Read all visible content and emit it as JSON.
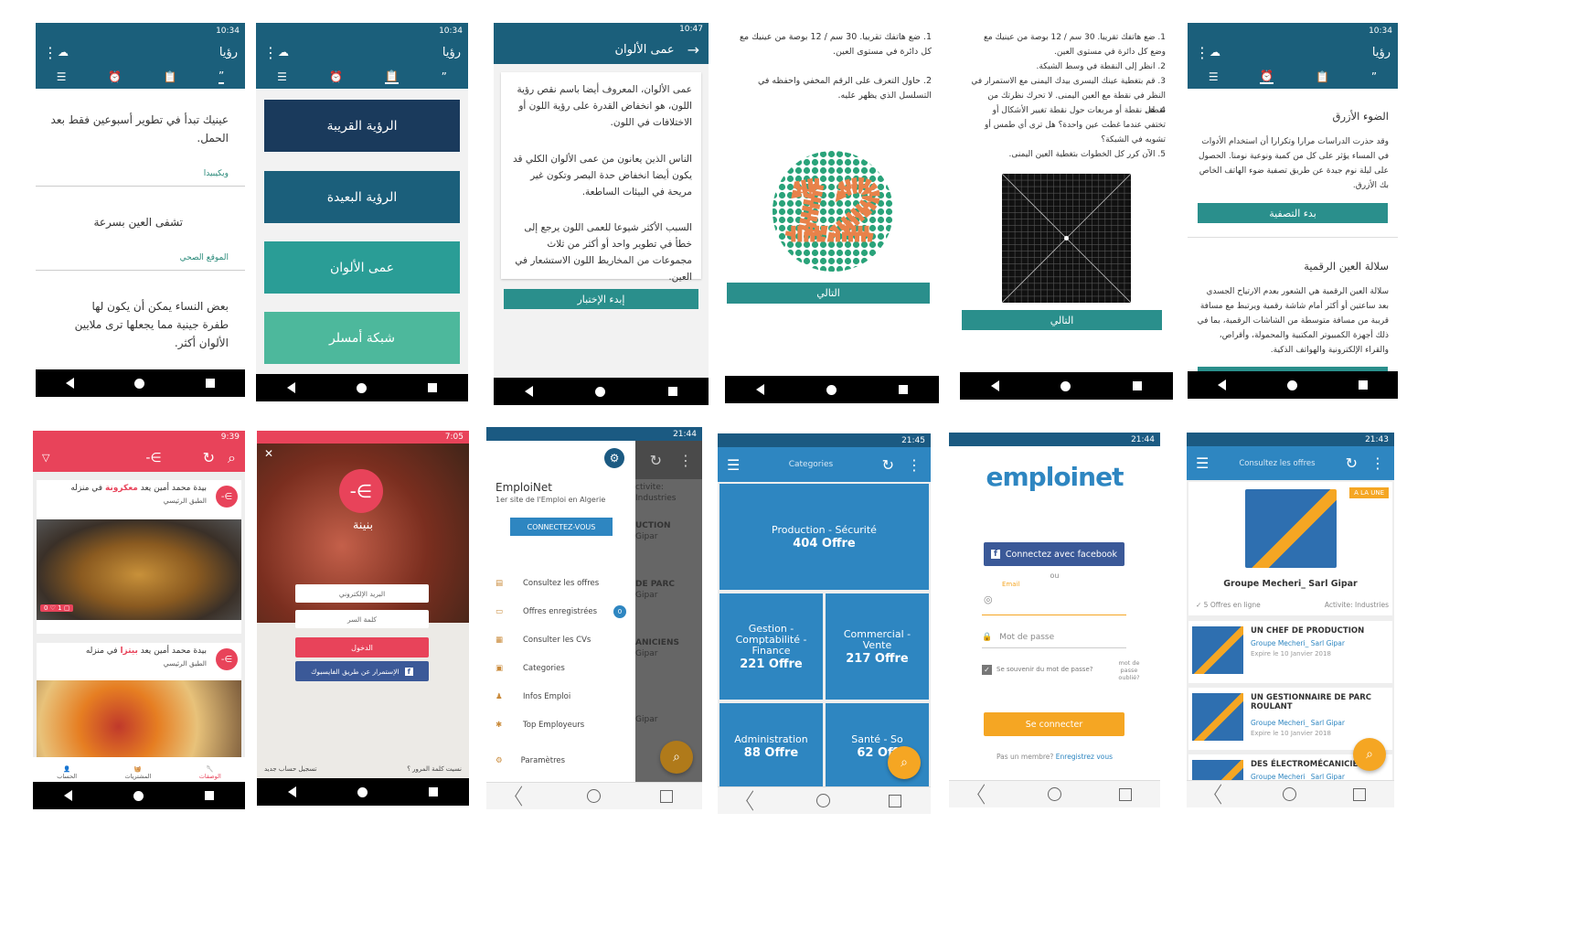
{
  "status": {
    "time1": "10:34",
    "time2": "10:34",
    "time3": "10:47",
    "time4": "10:34",
    "time5": "9:39",
    "time6": "7:05",
    "time7": "21:44",
    "time8": "21:45",
    "time9": "21:44",
    "time10": "21:43"
  },
  "s1": {
    "title": "رؤيا",
    "items": [
      {
        "text": "عينيك تبدأ في تطوير أسبوعين فقط بعد الحمل.",
        "src": "ويكيبيدا"
      },
      {
        "text": "تشفى العين بسرعة",
        "src": "الموقع الصحي"
      },
      {
        "text": "بعض النساء يمكن أن يكون لها طفرة جينية مما يجعلها ترى ملايين الألوان أكثر."
      }
    ]
  },
  "s2": {
    "title": "رؤيا",
    "cards": [
      "الرؤية القريبة",
      "الرؤية البعيدة",
      "عمى الألوان",
      "شبكة أمسلر"
    ]
  },
  "s3": {
    "title": "عمى الألوان",
    "p1": "عمى الألوان، المعروف أيضا باسم نقص رؤية اللون، هو انخفاض القدرة على رؤية اللون أو الاختلافات في اللون.",
    "p2": "الناس الذين يعانون من عمى الألوان الكلي قد يكون أيضا انخفاض حدة البصر وتكون غير مريحة في البيئات الساطعة.",
    "p3": "السبب الأكثر شيوعا للعمى اللون يرجع إلى خطأ في تطوير واحد أو أكثر من ثلاث مجموعات من المخاريط اللون الاستشعار في العين.",
    "btn": "إبدء الإختبار"
  },
  "s4": {
    "t1": "1. ضع هاتفك تقريبا. 30 سم / 12 بوصة من عينيك مع كل دائرة في مستوى العين.",
    "t2": "2. حاول التعرف على الرقم المخفي واحفظه في التسلسل الذي يظهر عليه.",
    "num": "12",
    "btn": "التالي"
  },
  "s5": {
    "lines": [
      "1. ضع هاتفك تقريبا. 30 سم / 12 بوصة من عينيك مع وضع كل دائرة في مستوى العين.",
      "2. انظر إلى النقطة في وسط الشبكة.",
      "3. قم بتغطية عينك اليسرى بيدك اليمنى مع الاستمرار في النظر في نقطة مع العين اليمنى. لا تحرك نظرتك من نقطة.",
      "4. هل نقطة أو مربعات حول نقطة تغيير الأشكال أو تختفي عندما غطت عين واحدة؟ هل ترى أي طمس أو تشويه في الشبكة؟",
      "5. الآن كرر كل الخطوات بتغطية العين اليمنى."
    ],
    "btn": "التالي"
  },
  "s6": {
    "title": "رؤيا",
    "h1": "الضوء الأزرق",
    "p1": "وقد حذرت الدراسات مرارا وتكرارا أن استخدام الأدوات في المساء يؤثر على كل من كمية ونوعية نومنا. الحصول على ليلة نوم جيدة عن طريق تصفية ضوء الهاتف الخاص بك الأزرق.",
    "btn": "بدء التصفية",
    "h2": "سلالة العين الرقمية",
    "p2": "سلالة العين الرقمية هي الشعور بعدم الارتياح الجسدي بعد ساعتين أو أكثر أمام شاشة رقمية ويرتبط مع مسافة قريبة من مسافة متوسطة من الشاشات الرقمية، بما في ذلك أجهزة الكمبيوتر المكتبية والمحمولة، وأقراص، والقراء الإلكترونية والهواتف الذكية."
  },
  "s7": {
    "posts": [
      {
        "pre": "بيدة محمد أمين يعد ",
        "dish": "معكرونة",
        "post": " في منزله",
        "sub": "الطبق الرئيسي"
      },
      {
        "pre": "بيدة محمد أمين يعد ",
        "dish": "بيتزا",
        "post": " في منزله",
        "sub": "الطبق الرئيسي"
      }
    ],
    "tabs": [
      "الوصفات",
      "المشتريات",
      "الحساب"
    ]
  },
  "s8": {
    "brand": "بنينة",
    "email": "البريد الإلكتروني",
    "pass": "كلمة السر",
    "login": "الدخول",
    "fb": "الإستمرار عن طريق الفايسبوك",
    "register": "تسجيل حساب جديد",
    "forgot": "نسيت كلمة المرور ؟"
  },
  "s9": {
    "brand": "EmploiNet",
    "tag": "1er site de l'Emploi en Algerie",
    "connect": "CONNECTEZ-VOUS",
    "menu": [
      "Consultez les offres",
      "Offres enregistrées",
      "Consulter les CVs",
      "Categories",
      "Infos Emploi",
      "Top Employeurs"
    ],
    "settings": "Paramètres",
    "badge": "0",
    "behind": [
      "ctivite: Industries",
      "UCTION",
      "Gipar",
      "DE PARC",
      "Gipar",
      "ANICIENS",
      "Gipar",
      "Gipar"
    ]
  },
  "s10": {
    "title": "Categories",
    "tiles": [
      {
        "name": "Production - Sécurité",
        "count": "404 Offre"
      },
      {
        "name": "Gestion - Comptabilité - Finance",
        "count": "221 Offre"
      },
      {
        "name": "Commercial - Vente",
        "count": "217 Offre"
      },
      {
        "name": "Administration",
        "count": "88 Offre"
      },
      {
        "name": "Santé - So",
        "count": "62 Off"
      }
    ]
  },
  "s11": {
    "logo": "emploinet",
    "fb": "Connectez avec facebook",
    "ou": "ou",
    "email_label": "Email",
    "pass_ph": "Mot de passe",
    "remember": "Se souvenir du mot de passe?",
    "forgot": "mot de passe oublié?",
    "login": "Se connecter",
    "signup_q": "Pas un membre?",
    "signup": "Enregistrez vous"
  },
  "s12": {
    "title": "Consultez les offres",
    "badge": "A LA UNE",
    "company": "Groupe Mecheri_ Sarl Gipar",
    "offers": "5 Offres en ligne",
    "activity": "Activite: Industries",
    "jobs": [
      {
        "title": "UN CHEF DE PRODUCTION",
        "co": "Groupe Mecheri_ Sarl Gipar",
        "exp": "Expire le 10 Janvier 2018"
      },
      {
        "title": "UN GESTIONNAIRE DE PARC ROULANT",
        "co": "Groupe Mecheri_ Sarl Gipar",
        "exp": "Expire le 10 Janvier 2018"
      },
      {
        "title": "DES ÉLECTROMÉCANICIEN",
        "co": "Groupe Mecheri_ Sarl Gipar",
        "exp": ""
      }
    ]
  }
}
